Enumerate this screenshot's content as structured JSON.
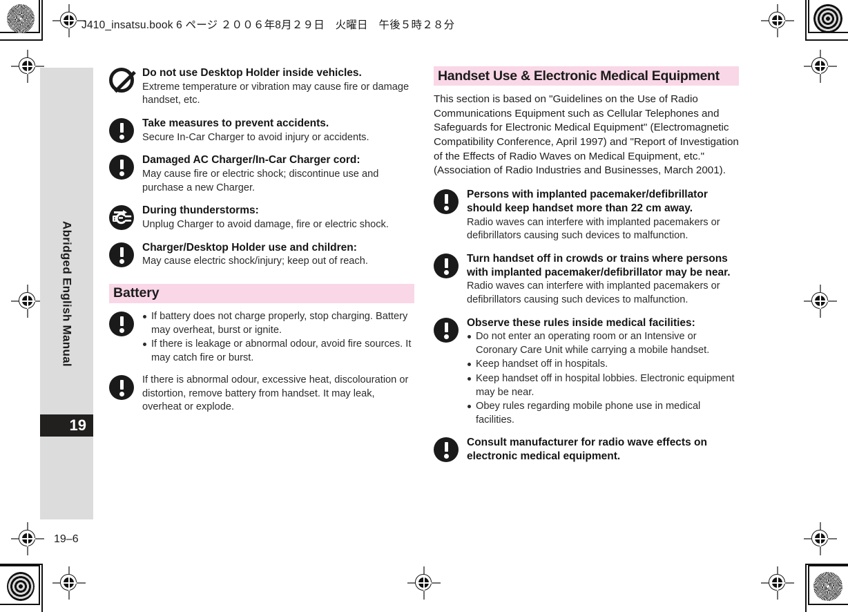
{
  "header": {
    "slug": "J410_insatsu.book  6 ページ  ２００６年8月２９日　火曜日　午後５時２８分"
  },
  "sidebar": {
    "label": "Abridged English Manual",
    "chapter_number": "19"
  },
  "folio": "19–6",
  "left_column": {
    "items": [
      {
        "icon": "prohibition-icon",
        "title": "Do not use Desktop Holder inside vehicles.",
        "body": "Extreme temperature or vibration may cause fire or damage handset, etc."
      },
      {
        "icon": "exclamation-icon",
        "title": "Take measures to prevent accidents.",
        "body": "Secure In-Car Charger to avoid injury or accidents."
      },
      {
        "icon": "exclamation-icon",
        "title": "Damaged AC Charger/In-Car Charger cord:",
        "body": "May cause fire or electric shock; discontinue use and purchase a new Charger."
      },
      {
        "icon": "unplug-icon",
        "title": "During thunderstorms:",
        "body": "Unplug Charger to avoid damage, fire or electric shock."
      },
      {
        "icon": "exclamation-icon",
        "title": "Charger/Desktop Holder use and children:",
        "body": "May cause electric shock/injury; keep out of reach."
      }
    ],
    "battery_heading": "Battery",
    "battery_items": [
      {
        "icon": "exclamation-icon",
        "bullets": [
          "If battery does not charge properly, stop charging. Battery may overheat, burst or ignite.",
          "If there is leakage or abnormal odour, avoid fire sources. It may catch fire or burst."
        ]
      },
      {
        "icon": "exclamation-icon",
        "body": "If there is abnormal odour, excessive heat, discolouration or distortion, remove battery from handset. It may leak, overheat or explode."
      }
    ]
  },
  "right_column": {
    "heading": "Handset Use & Electronic Medical Equipment",
    "intro": "This section is based on \"Guidelines on the Use of Radio Communications Equipment such as Cellular Telephones and Safeguards for Electronic Medical Equipment\" (Electromagnetic Compatibility Conference, April 1997) and \"Report of Investigation of the Effects of Radio Waves on Medical Equipment, etc.\" (Association of Radio Industries and Businesses, March 2001).",
    "items": [
      {
        "icon": "exclamation-icon",
        "title": "Persons with implanted pacemaker/defibrillator should keep handset more than 22 cm away.",
        "body": "Radio waves can interfere with implanted pacemakers or defibrillators causing such devices to malfunction."
      },
      {
        "icon": "exclamation-icon",
        "title": "Turn handset off in crowds or trains where persons with implanted pacemaker/defibrillator may be near.",
        "body": "Radio waves can interfere with implanted pacemakers or defibrillators causing such devices to malfunction."
      },
      {
        "icon": "exclamation-icon",
        "title": "Observe these rules inside medical facilities:",
        "bullets": [
          "Do not enter an operating room or an Intensive or Coronary Care Unit while carrying a mobile handset.",
          "Keep handset off in hospitals.",
          "Keep handset off in hospital lobbies. Electronic equipment may be near.",
          "Obey rules regarding mobile phone use in medical facilities."
        ]
      },
      {
        "icon": "exclamation-icon",
        "title": "Consult manufacturer for radio wave effects on electronic medical equipment."
      }
    ]
  },
  "colors": {
    "heading_pink": "#f9d7e6",
    "sidebar_grey": "#dcdcdc",
    "chapter_tab_black": "#221f1f"
  }
}
